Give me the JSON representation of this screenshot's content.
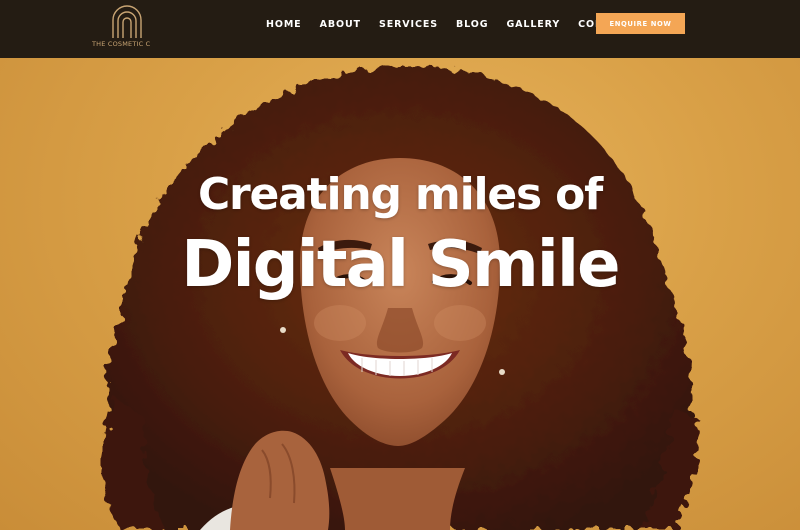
{
  "brand": {
    "name": "THE COSMETIC C",
    "logo_icon": "arch-logo-icon",
    "accent_color": "#c9a574"
  },
  "nav": {
    "items": [
      {
        "label": "HOME"
      },
      {
        "label": "ABOUT"
      },
      {
        "label": "SERVICES"
      },
      {
        "label": "BLOG"
      },
      {
        "label": "GALLERY"
      },
      {
        "label": "CONTACT"
      }
    ],
    "cta_label": "ENQUIRE NOW",
    "cta_color": "#f4a655"
  },
  "hero": {
    "line1": "Creating miles of",
    "line2": "Digital Smile",
    "background_color": "#dca34b",
    "image": "smiling-woman-curly-hair-photo"
  }
}
